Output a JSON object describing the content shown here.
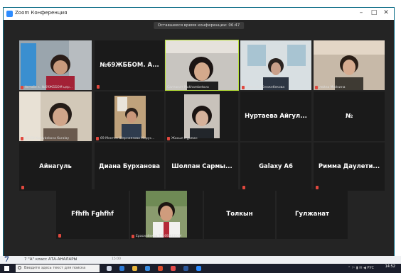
{
  "window": {
    "title": "Zoom Конференция",
    "banner": "Оставшееся время конференции: 06:47"
  },
  "tiles": {
    "r1": [
      {
        "caption": "Актобе к. №69ЖББОМ цер..."
      },
      {
        "name": "№69ЖББОМ. А..."
      },
      {
        "caption": "Салтанат Mukhambetova"
      },
      {
        "caption": "Гүлсезім Кенжебекова"
      },
      {
        "caption": "лейла Мейкина"
      }
    ],
    "r2": [
      {
        "caption": "НБ.Бб Kaldybekova Kuralay"
      },
      {
        "caption": "69 Мектеп Шерниязова Мерус..."
      },
      {
        "caption": "Жасыл Нұржан"
      },
      {
        "name": "Нуртаева Айгул..."
      },
      {
        "name": "№"
      }
    ],
    "r3": [
      {
        "name": "Айнагуль"
      },
      {
        "name": "Диана Бурханова"
      },
      {
        "name": "Шолпан Сармы..."
      },
      {
        "name": "Galaxy A6"
      },
      {
        "name": "Римма Даулети..."
      }
    ],
    "r4": [
      {
        "name": "Ffhfh Fghfhf"
      },
      {
        "caption": "Ерасилбеков Т.Т.69ЖББОМ"
      },
      {
        "name": "Толкын"
      },
      {
        "name": "Гулжанат"
      }
    ]
  },
  "behind_window": {
    "text": "7 \"А\" класс АТА-АНАЛАРЫ",
    "time": "15:00"
  },
  "taskbar": {
    "search_placeholder": "Введите здесь текст для поиска",
    "time": "14:52",
    "date": ""
  },
  "colors": {
    "active_speaker": "#b7e038",
    "muted": "#e0483e",
    "zoom_blue": "#2d8cff"
  }
}
